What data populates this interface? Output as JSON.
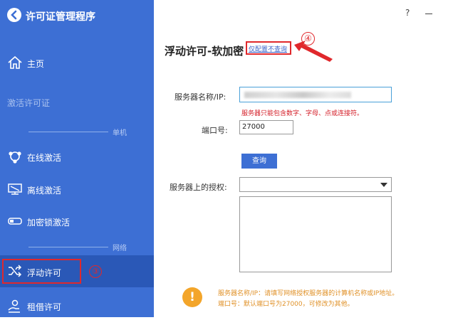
{
  "app": {
    "title": "许可证管理程序",
    "help": "?"
  },
  "sidebar": {
    "home": "主页",
    "activate_license": "激活许可证",
    "section_single": "单机",
    "online_activation": "在线激活",
    "offline_activation": "离线激活",
    "dongle_activation": "加密锁激活",
    "section_network": "网络",
    "floating_license": "浮动许可",
    "borrow_license": "租借许可"
  },
  "main": {
    "title": "浮动许可-软加密",
    "config_link": "仅配置不查询",
    "server_label": "服务器名称/IP:",
    "server_error": "服务器只能包含数字、字母、点或连接符。",
    "port_label": "端口号:",
    "port_value": "27000",
    "query_button": "查询",
    "licenses_label": "服务器上的授权:",
    "tip_line1": "服务器名称/IP：请填写网络授权服务器的计算机名称或IP地址。",
    "tip_line2": "端口号：默认端口号为27000，可修改为其他。"
  },
  "annotations": {
    "marker3": "③",
    "marker4": "④"
  },
  "colors": {
    "sidebar": "#3d6fd4",
    "active_item": "#2a58b7",
    "annotation": "#e0282c",
    "tip": "#e0922a"
  }
}
